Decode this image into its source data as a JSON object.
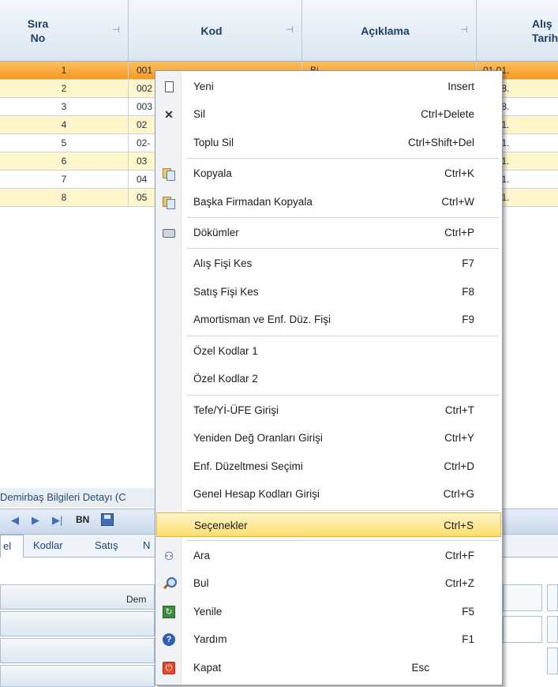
{
  "grid": {
    "columns": [
      {
        "label": "Sıra\nNo"
      },
      {
        "label": "Kod"
      },
      {
        "label": "Açıklama"
      },
      {
        "label": "Alış\nTarih"
      }
    ],
    "rows": [
      {
        "no": "1",
        "kod": "001",
        "aciklama": "Bi",
        "tarih": "01.01."
      },
      {
        "no": "2",
        "kod": "002",
        "aciklama": "",
        "tarih": "15.08."
      },
      {
        "no": "3",
        "kod": "003",
        "aciklama": "",
        "tarih": "15.08."
      },
      {
        "no": "4",
        "kod": "02",
        "aciklama": "",
        "tarih": "01.01."
      },
      {
        "no": "5",
        "kod": "02-",
        "aciklama": "",
        "tarih": "01.01."
      },
      {
        "no": "6",
        "kod": "03",
        "aciklama": "",
        "tarih": "01.01."
      },
      {
        "no": "7",
        "kod": "04",
        "aciklama": "",
        "tarih": "01.01."
      },
      {
        "no": "8",
        "kod": "05",
        "aciklama": "",
        "tarih": "01.01."
      }
    ]
  },
  "detail": {
    "title": "Demirbaş Bilgileri Detayı (C",
    "bn_label": "BN",
    "tabs": [
      "el",
      "Kodlar",
      "Satış",
      "N"
    ],
    "table_header": "Dem"
  },
  "menu": {
    "items": [
      {
        "label": "Yeni",
        "shortcut": "Insert",
        "icon": "new-document-icon"
      },
      {
        "label": "Sil",
        "shortcut": "Ctrl+Delete",
        "icon": "delete-x-icon"
      },
      {
        "label": "Toplu Sil",
        "shortcut": "Ctrl+Shift+Del",
        "icon": ""
      },
      {
        "label": "Kopyala",
        "shortcut": "Ctrl+K",
        "icon": "copy-icon"
      },
      {
        "label": "Başka Firmadan Kopyala",
        "shortcut": "Ctrl+W",
        "icon": "copy-icon"
      },
      {
        "label": "Dökümler",
        "shortcut": "Ctrl+P",
        "icon": "printer-icon"
      },
      {
        "label": "Alış Fişi Kes",
        "shortcut": "F7",
        "icon": ""
      },
      {
        "label": "Satış Fişi Kes",
        "shortcut": "F8",
        "icon": ""
      },
      {
        "label": "Amortisman ve Enf. Düz. Fişi",
        "shortcut": "F9",
        "icon": ""
      },
      {
        "label": "Özel Kodlar 1",
        "shortcut": "",
        "icon": ""
      },
      {
        "label": "Özel Kodlar 2",
        "shortcut": "",
        "icon": ""
      },
      {
        "label": "Tefe/Yİ-ÜFE Girişi",
        "shortcut": "Ctrl+T",
        "icon": ""
      },
      {
        "label": "Yeniden Değ Oranları Girişi",
        "shortcut": "Ctrl+Y",
        "icon": ""
      },
      {
        "label": "Enf. Düzeltmesi Seçimi",
        "shortcut": "Ctrl+D",
        "icon": ""
      },
      {
        "label": "Genel Hesap Kodları Girişi",
        "shortcut": "Ctrl+G",
        "icon": ""
      },
      {
        "label": "Seçenekler",
        "shortcut": "Ctrl+S",
        "icon": "",
        "highlighted": true
      },
      {
        "label": "Ara",
        "shortcut": "Ctrl+F",
        "icon": "binoculars-icon"
      },
      {
        "label": "Bul",
        "shortcut": "Ctrl+Z",
        "icon": "magnifier-icon"
      },
      {
        "label": "Yenile",
        "shortcut": "F5",
        "icon": "refresh-icon"
      },
      {
        "label": "Yardım",
        "shortcut": "F1",
        "icon": "help-icon"
      },
      {
        "label": "Kapat",
        "shortcut": "Esc",
        "icon": "close-icon"
      }
    ]
  },
  "colors": {
    "selected_row": "#f7a12a",
    "alt_row": "#fff6cc",
    "menu_highlight": "#ffdd6e",
    "header_text": "#1e3f66"
  }
}
